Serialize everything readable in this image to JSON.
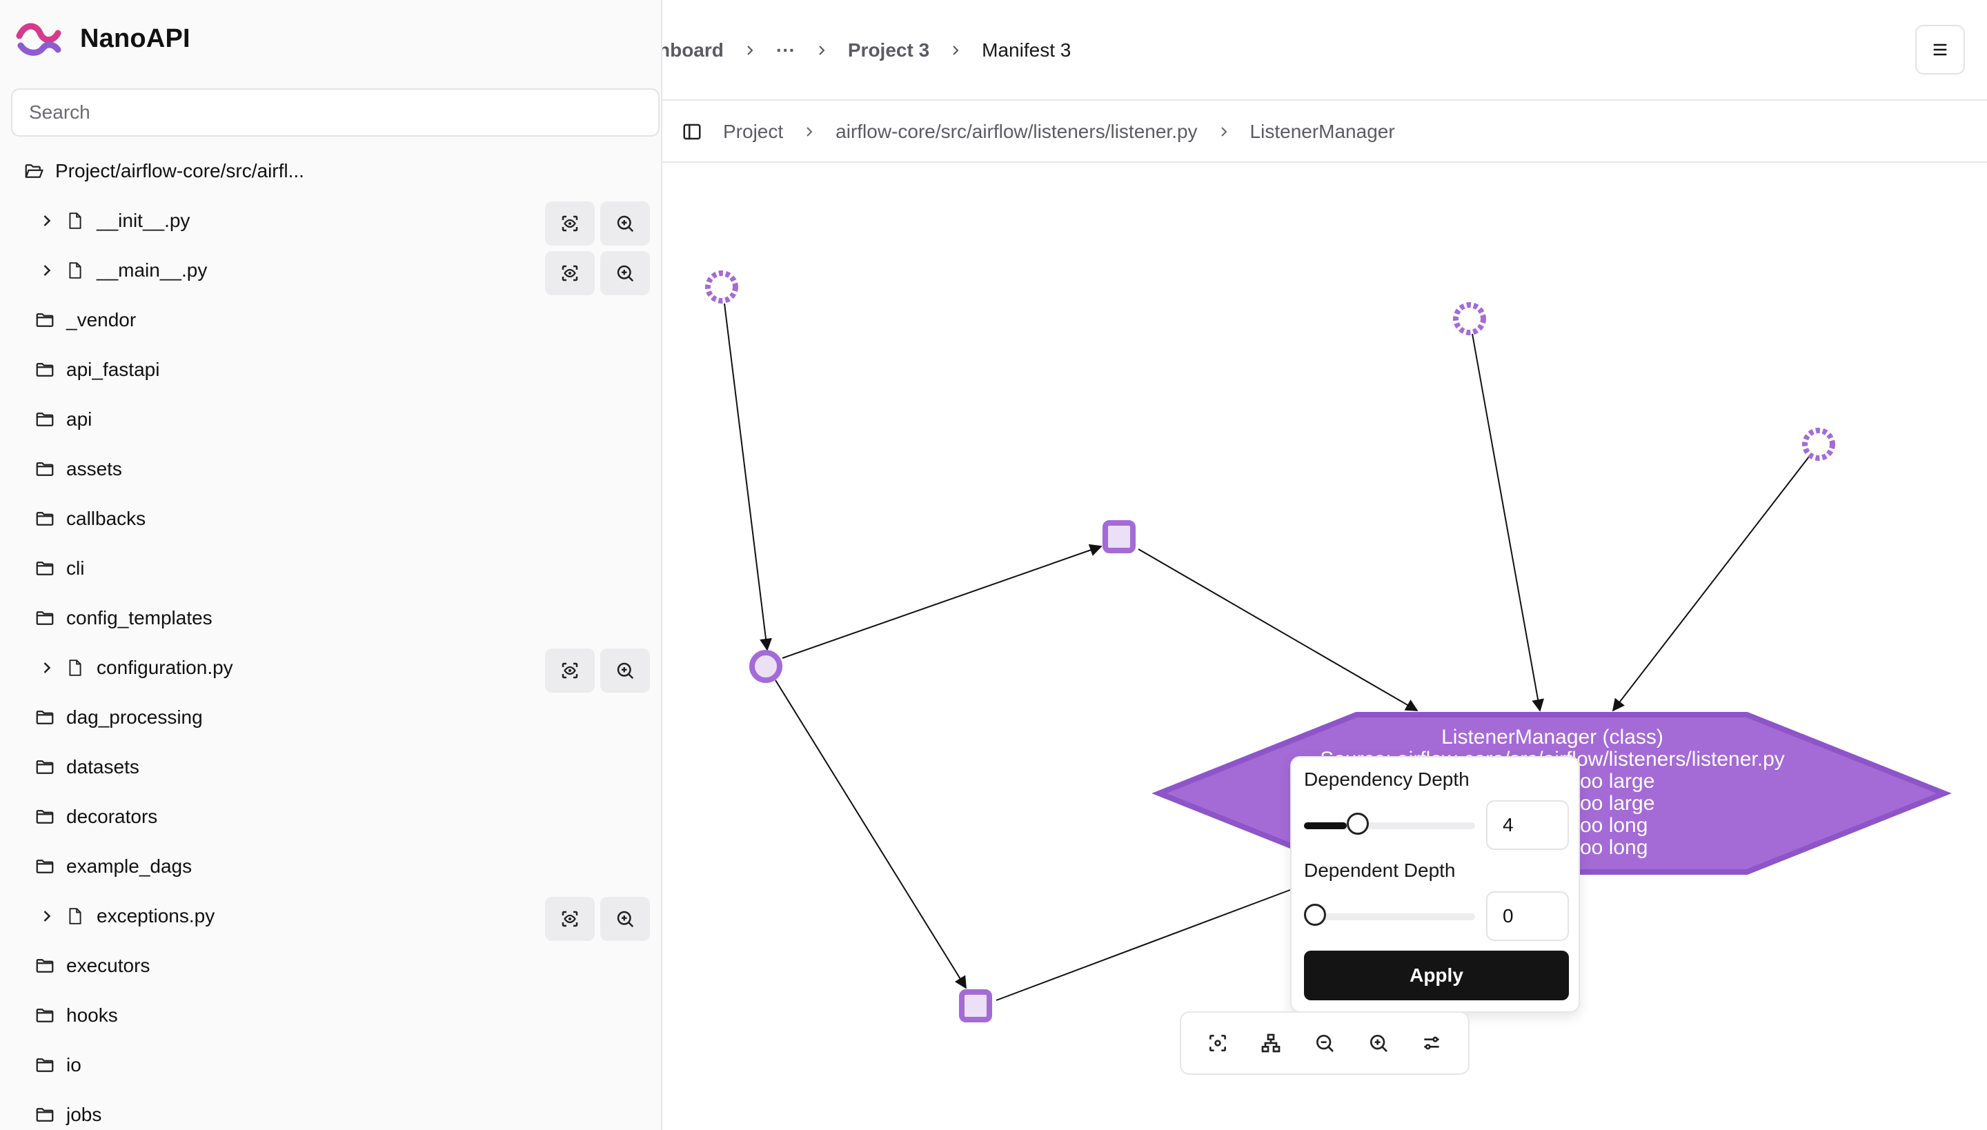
{
  "app": {
    "name": "NanoAPI",
    "brand_color": "#d63a8a"
  },
  "search": {
    "placeholder": "Search"
  },
  "tree": {
    "root": "Project/airflow-core/src/airfl...",
    "items": [
      {
        "type": "file",
        "label": "__init__.py",
        "actions": [
          "focus-icon",
          "zoom-in-icon"
        ]
      },
      {
        "type": "file",
        "label": "__main__.py",
        "actions": [
          "focus-icon",
          "zoom-in-icon"
        ]
      },
      {
        "type": "folder",
        "label": "_vendor"
      },
      {
        "type": "folder",
        "label": "api_fastapi"
      },
      {
        "type": "folder",
        "label": "api"
      },
      {
        "type": "folder",
        "label": "assets"
      },
      {
        "type": "folder",
        "label": "callbacks"
      },
      {
        "type": "folder",
        "label": "cli"
      },
      {
        "type": "folder",
        "label": "config_templates"
      },
      {
        "type": "file",
        "label": "configuration.py",
        "actions": [
          "focus-icon",
          "zoom-in-icon"
        ]
      },
      {
        "type": "folder",
        "label": "dag_processing"
      },
      {
        "type": "folder",
        "label": "datasets"
      },
      {
        "type": "folder",
        "label": "decorators"
      },
      {
        "type": "folder",
        "label": "example_dags"
      },
      {
        "type": "file",
        "label": "exceptions.py",
        "actions": [
          "focus-icon",
          "zoom-in-icon"
        ]
      },
      {
        "type": "folder",
        "label": "executors"
      },
      {
        "type": "folder",
        "label": "hooks"
      },
      {
        "type": "folder",
        "label": "io"
      },
      {
        "type": "folder",
        "label": "jobs"
      }
    ]
  },
  "topbar": {
    "crumbs": [
      "hboard",
      "···",
      "Project 3",
      "Manifest 3"
    ]
  },
  "subbar": {
    "crumbs": [
      "Project",
      "airflow-core/src/airflow/listeners/listener.py",
      "ListenerManager"
    ]
  },
  "graph": {
    "node_color": "#a46ad6",
    "main_node": {
      "lines": [
        "ListenerManager (class)",
        "Source: airflow-core/src/airflow/listeners/listener.py",
        "...oo large",
        "...oo large",
        "...oo long",
        "...oo long"
      ],
      "visible_tails": [
        "oo large",
        "oo large",
        "oo long",
        "oo long"
      ]
    }
  },
  "popover": {
    "dependency_label": "Dependency Depth",
    "dependency_value": "4",
    "dependency_fraction": 0.25,
    "dependent_label": "Dependent Depth",
    "dependent_value": "0",
    "dependent_fraction": 0,
    "apply_label": "Apply"
  },
  "toolbar": {
    "buttons": [
      "fit-view-icon",
      "layout-icon",
      "zoom-out-icon",
      "zoom-in-icon",
      "settings-icon"
    ]
  }
}
